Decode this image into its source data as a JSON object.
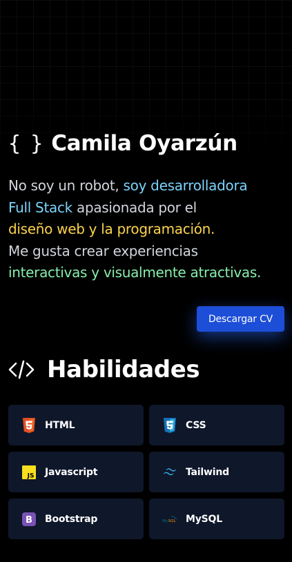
{
  "hero": {
    "title": "Camila Oyarzún",
    "icon": "braces-icon",
    "braces_glyph": "{ }"
  },
  "intro": {
    "line1_a": "No soy un robot, ",
    "line1_b": "soy desarrolladora",
    "line2_a": "Full Stack",
    "line2_b": " apasionada por el",
    "line3": "diseño web y la programación.",
    "line4": "Me gusta crear experiencias",
    "line5": "interactivas y visualmente atractivas."
  },
  "cv_button": {
    "label": "Descargar CV"
  },
  "skills": {
    "title": "Habilidades",
    "icon": "code-icon",
    "items": [
      {
        "label": "HTML",
        "icon": "html5-icon"
      },
      {
        "label": "CSS",
        "icon": "css3-icon"
      },
      {
        "label": "Javascript",
        "icon": "javascript-icon"
      },
      {
        "label": "Tailwind",
        "icon": "tailwind-icon"
      },
      {
        "label": "Bootstrap",
        "icon": "bootstrap-icon"
      },
      {
        "label": "MySQL",
        "icon": "mysql-icon"
      }
    ]
  },
  "colors": {
    "background": "#000000",
    "accent_blue": "#7dd3fc",
    "accent_yellow": "#fcd34d",
    "accent_green": "#86efac",
    "button": "#1d4ed8",
    "card": "#0f172a"
  }
}
